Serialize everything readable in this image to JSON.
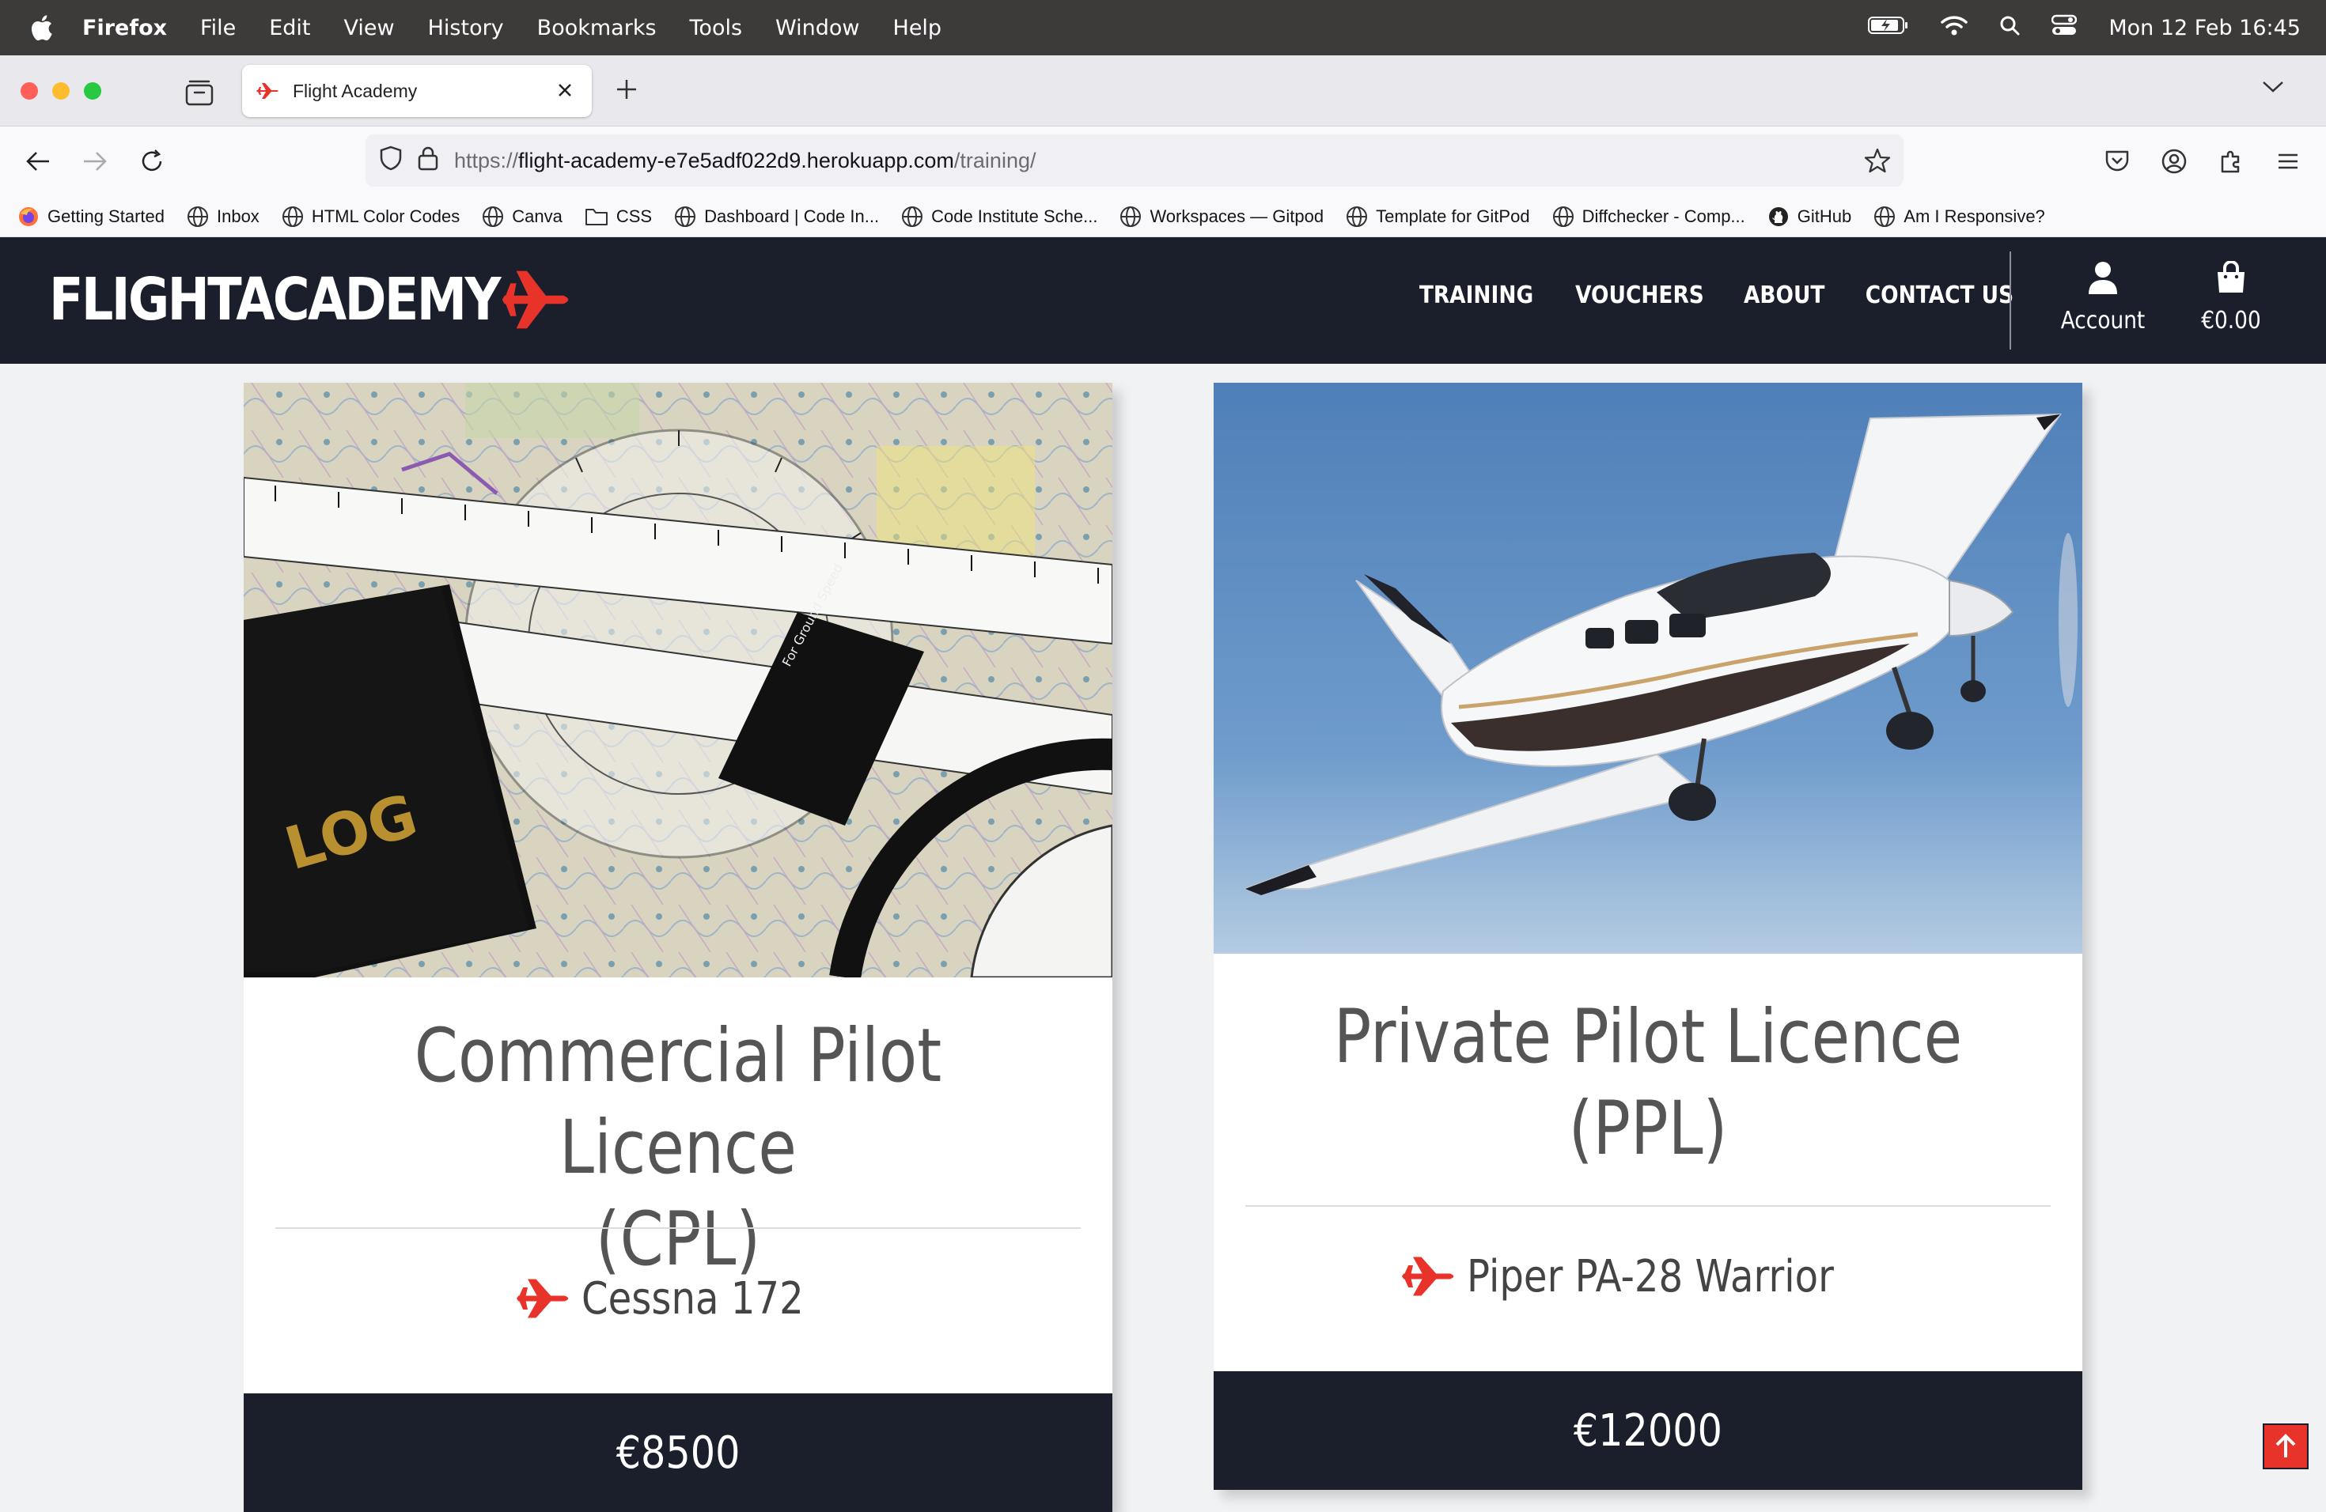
{
  "menubar": {
    "app_name": "Firefox",
    "menus": [
      "File",
      "Edit",
      "View",
      "History",
      "Bookmarks",
      "Tools",
      "Window",
      "Help"
    ],
    "clock": "Mon 12 Feb  16:45"
  },
  "browser": {
    "tab_title": "Flight Academy",
    "url_prefix": "https://",
    "url_host": "flight-academy-e7e5adf022d9.herokuapp.com",
    "url_path": "/training/",
    "bookmarks": [
      {
        "label": "Getting Started",
        "icon": "firefox-icon"
      },
      {
        "label": "Inbox",
        "icon": "globe-icon"
      },
      {
        "label": "HTML Color Codes",
        "icon": "globe-icon"
      },
      {
        "label": "Canva",
        "icon": "globe-icon"
      },
      {
        "label": "CSS",
        "icon": "folder-icon"
      },
      {
        "label": "Dashboard | Code In...",
        "icon": "globe-icon"
      },
      {
        "label": "Code Institute Sche...",
        "icon": "globe-icon"
      },
      {
        "label": "Workspaces — Gitpod",
        "icon": "globe-icon"
      },
      {
        "label": "Template for GitPod",
        "icon": "globe-icon"
      },
      {
        "label": "Diffchecker - Comp...",
        "icon": "globe-icon"
      },
      {
        "label": "GitHub",
        "icon": "github-icon"
      },
      {
        "label": "Am I Responsive?",
        "icon": "globe-icon"
      }
    ]
  },
  "site": {
    "logo_text": "FLIGHTACADEMY",
    "nav": {
      "training": "TRAINING",
      "vouchers": "VOUCHERS",
      "about": "ABOUT",
      "contact": "CONTACT US"
    },
    "account_label": "Account",
    "basket_total": "€0.00",
    "accent_color": "#e8332a",
    "header_color": "#1a1f2b"
  },
  "cards": [
    {
      "title_line1": "Commercial Pilot Licence",
      "title_line2": "(CPL)",
      "aircraft": "Cessna 172",
      "price": "€8500",
      "image": "aviation-chart-plotter-logbook"
    },
    {
      "title_line1": "Private Pilot Licence",
      "title_line2": "(PPL)",
      "aircraft": "Piper PA-28 Warrior",
      "price": "€12000",
      "image": "piper-aircraft-in-flight"
    }
  ]
}
